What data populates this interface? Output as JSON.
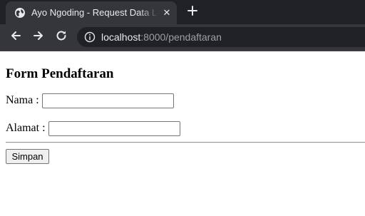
{
  "browser": {
    "tab": {
      "title": "Ayo Ngoding - Request Data Laravel",
      "favicon": "globe-icon",
      "close_symbol": "✕"
    },
    "new_tab_icon": "plus-icon",
    "nav": {
      "back_icon": "arrow-left-icon",
      "forward_icon": "arrow-right-icon",
      "reload_icon": "reload-icon"
    },
    "address": {
      "site_info_icon": "info-icon",
      "host": "localhost",
      "rest": ":8000/pendaftaran"
    },
    "colors": {
      "tabstrip": "#202124",
      "toolbar": "#35363a",
      "text": "#e8eaed",
      "muted_text": "#9aa0a6"
    }
  },
  "form": {
    "title": "Form Pendaftaran",
    "fields": [
      {
        "label": "Nama :",
        "value": ""
      },
      {
        "label": "Alamat :",
        "value": ""
      }
    ],
    "submit_label": "Simpan"
  }
}
